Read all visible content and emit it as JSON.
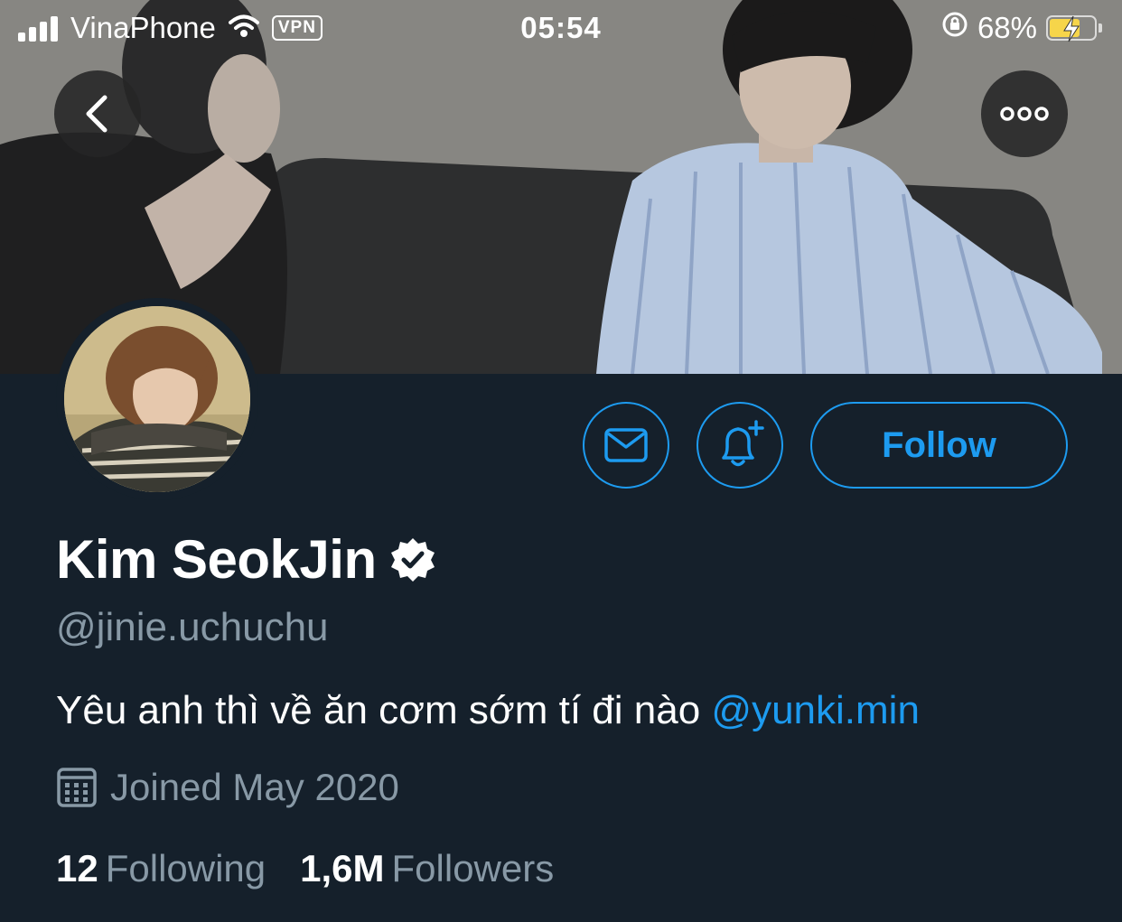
{
  "status_bar": {
    "carrier": "VinaPhone",
    "vpn": "VPN",
    "time": "05:54",
    "battery_text": "68%",
    "battery_level": 0.68
  },
  "profile": {
    "display_name": "Kim SeokJin",
    "verified": true,
    "handle": "@jinie.uchuchu",
    "bio_text": "Yêu anh thì về ăn cơm sớm tí đi nào",
    "bio_mention": "@yunki.min",
    "joined": "Joined May 2020",
    "following_count": "12",
    "following_label": "Following",
    "followers_count": "1,6M",
    "followers_label": "Followers"
  },
  "actions": {
    "follow_label": "Follow"
  },
  "colors": {
    "background": "#15202b",
    "accent": "#1d9bf0",
    "secondary_text": "#8899a6"
  },
  "icons": [
    "back-arrow-icon",
    "more-icon",
    "mail-icon",
    "bell-plus-icon",
    "verified-badge-icon",
    "calendar-icon",
    "wifi-icon",
    "signal-icon",
    "rotation-lock-icon",
    "battery-icon"
  ]
}
